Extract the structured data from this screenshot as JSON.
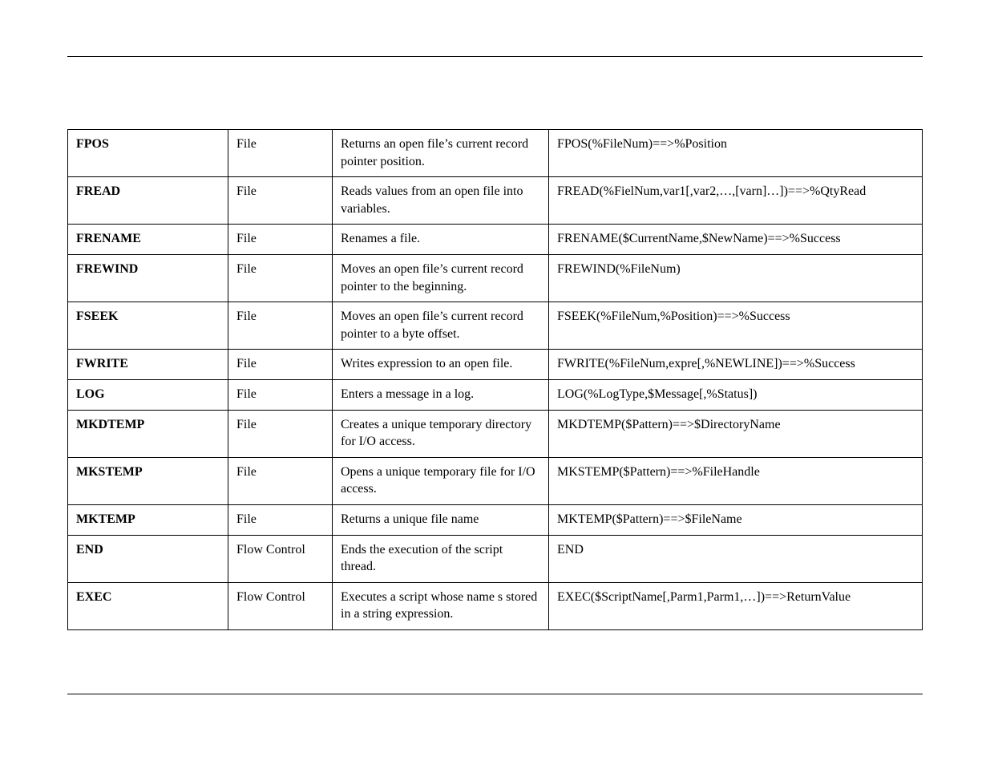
{
  "rows": [
    {
      "name": "FPOS",
      "type": "File",
      "desc": "Returns an open file’s current record pointer position.",
      "syntax": "FPOS(%FileNum)==>%Position"
    },
    {
      "name": "FREAD",
      "type": "File",
      "desc": "Reads values from an open file into variables.",
      "syntax": "FREAD(%FielNum,var1[,var2,…,[varn]…])==>%QtyRead"
    },
    {
      "name": "FRENAME",
      "type": "File",
      "desc": "Renames a file.",
      "syntax": "FRENAME($CurrentName,$NewName)==>%Success"
    },
    {
      "name": "FREWIND",
      "type": "File",
      "desc": "Moves an open file’s current record pointer to the beginning.",
      "syntax": "FREWIND(%FileNum)"
    },
    {
      "name": "FSEEK",
      "type": "File",
      "desc": "Moves an open file’s current record pointer to a byte offset.",
      "syntax": "FSEEK(%FileNum,%Position)==>%Success"
    },
    {
      "name": "FWRITE",
      "type": "File",
      "desc": "Writes expression to an open file.",
      "syntax": "FWRITE(%FileNum,expre[,%NEWLINE])==>%Success"
    },
    {
      "name": "LOG",
      "type": "File",
      "desc": "Enters a message in a log.",
      "syntax": "LOG(%LogType,$Message[,%Status])"
    },
    {
      "name": "MKDTEMP",
      "type": "File",
      "desc": "Creates a unique temporary directory for I/O access.",
      "syntax": "MKDTEMP($Pattern)==>$DirectoryName"
    },
    {
      "name": "MKSTEMP",
      "type": "File",
      "desc": "Opens a unique temporary file for I/O access.",
      "syntax": "MKSTEMP($Pattern)==>%FileHandle"
    },
    {
      "name": "MKTEMP",
      "type": "File",
      "desc": "Returns a unique file name",
      "syntax": "MKTEMP($Pattern)==>$FileName"
    },
    {
      "name": "END",
      "type": "Flow Control",
      "desc": "Ends the execution of the script thread.",
      "syntax": "END"
    },
    {
      "name": "EXEC",
      "type": "Flow Control",
      "desc": "Executes a script whose name s stored in a string expression.",
      "syntax": "EXEC($ScriptName[,Parm1,Parm1,…])==>ReturnValue"
    }
  ]
}
